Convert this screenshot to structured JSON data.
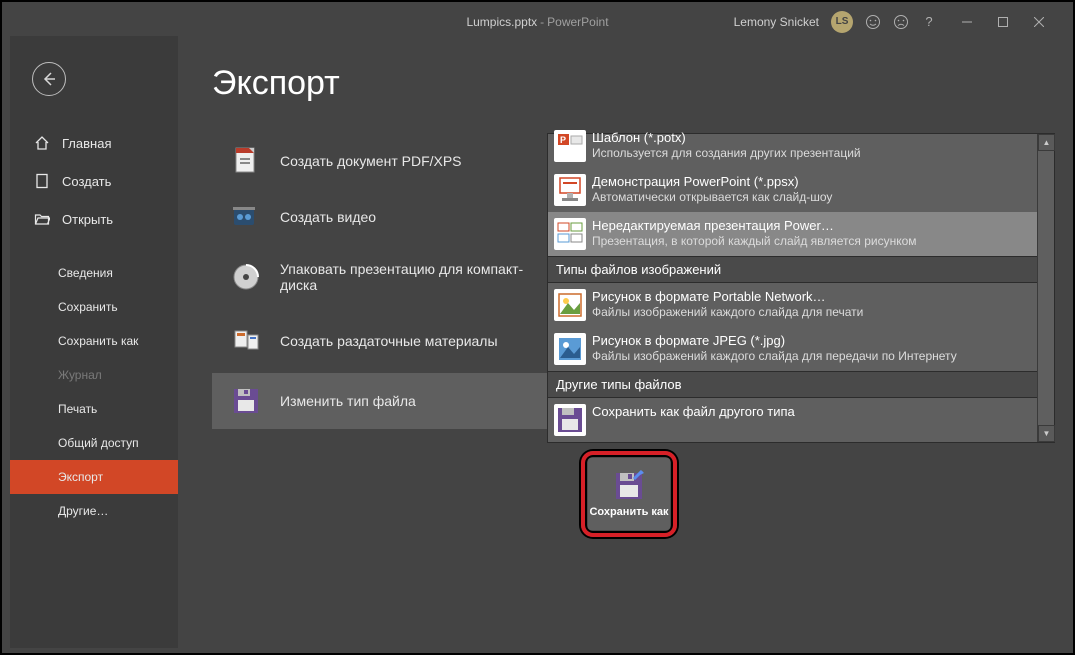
{
  "title": {
    "doc": "Lumpics.pptx",
    "sep": " - ",
    "app": "PowerPoint"
  },
  "user": {
    "name": "Lemony Snicket",
    "initials": "LS"
  },
  "sidebar": {
    "back_aria": "Назад",
    "top": [
      {
        "label": "Главная",
        "icon": "home"
      },
      {
        "label": "Создать",
        "icon": "new"
      },
      {
        "label": "Открыть",
        "icon": "open"
      }
    ],
    "sub": [
      {
        "label": "Сведения"
      },
      {
        "label": "Сохранить"
      },
      {
        "label": "Сохранить как"
      },
      {
        "label": "Журнал",
        "disabled": true
      },
      {
        "label": "Печать"
      },
      {
        "label": "Общий доступ"
      },
      {
        "label": "Экспорт",
        "active": true
      },
      {
        "label": "Другие…"
      }
    ]
  },
  "page_title": "Экспорт",
  "export_menu": [
    {
      "label": "Создать документ PDF/XPS",
      "icon": "pdf"
    },
    {
      "label": "Создать видео",
      "icon": "video"
    },
    {
      "label": "Упаковать презентацию для компакт-диска",
      "icon": "cd",
      "tall": true
    },
    {
      "label": "Создать раздаточные материалы",
      "icon": "handout",
      "tall": true
    },
    {
      "label": "Изменить тип файла",
      "icon": "change",
      "active": true
    }
  ],
  "filetypes": {
    "groups": [
      {
        "items": [
          {
            "title": "Шаблон (*.potx)",
            "desc": "Используется для создания других презентаций",
            "kind": "potx",
            "truncated": true
          },
          {
            "title": "Демонстрация PowerPoint (*.ppsx)",
            "desc": "Автоматически открывается как слайд-шоу",
            "kind": "ppsx"
          },
          {
            "title": "Нередактируемая презентация Power…",
            "desc": "Презентация, в которой каждый слайд является рисунком",
            "kind": "pic",
            "selected": true
          }
        ]
      },
      {
        "header": "Типы файлов изображений",
        "items": [
          {
            "title": "Рисунок в формате Portable Network…",
            "desc": "Файлы изображений каждого слайда для печати",
            "kind": "png"
          },
          {
            "title": "Рисунок в формате JPEG (*.jpg)",
            "desc": "Файлы изображений каждого слайда для передачи по Интернету",
            "kind": "jpg"
          }
        ]
      },
      {
        "header": "Другие типы файлов",
        "items": [
          {
            "title": "Сохранить как файл другого типа",
            "desc": "",
            "kind": "other"
          }
        ]
      }
    ]
  },
  "save_button": "Сохранить как"
}
